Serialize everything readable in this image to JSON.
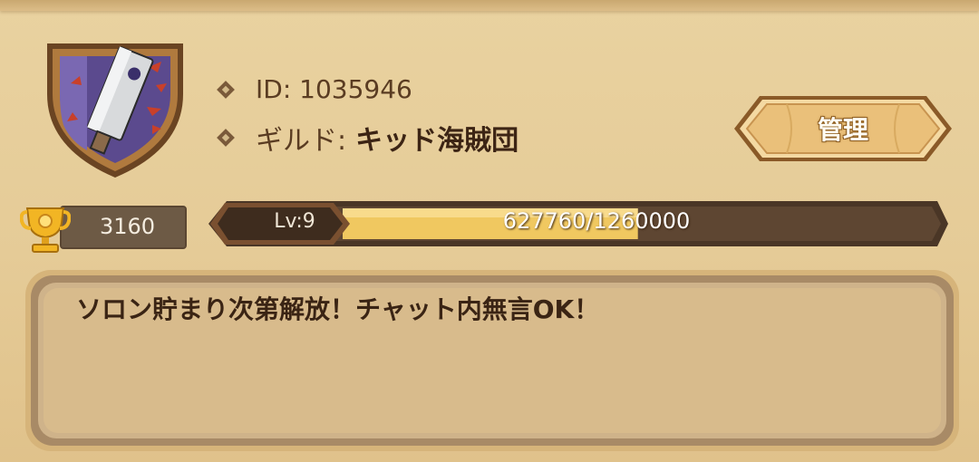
{
  "guild": {
    "id_text": "ID: 1035946",
    "name_prefix": "ギルド:",
    "name": "キッド海賊団"
  },
  "buttons": {
    "manage_label": "管理"
  },
  "trophy": {
    "value": "3160",
    "icon": "trophy-icon"
  },
  "level": {
    "label": "Lv:9",
    "xp_current": "627760",
    "xp_separator": "/",
    "xp_total": "1260000",
    "progress_fraction": 0.498
  },
  "message": "ソロン貯まり次第解放！チャット内無言OK！",
  "colors": {
    "panel": "#e6cc98",
    "xp_fill": "#f0c860",
    "text_dark": "#3a2414",
    "emblem_purple": "#5b4a8e",
    "emblem_red": "#c8402a"
  }
}
